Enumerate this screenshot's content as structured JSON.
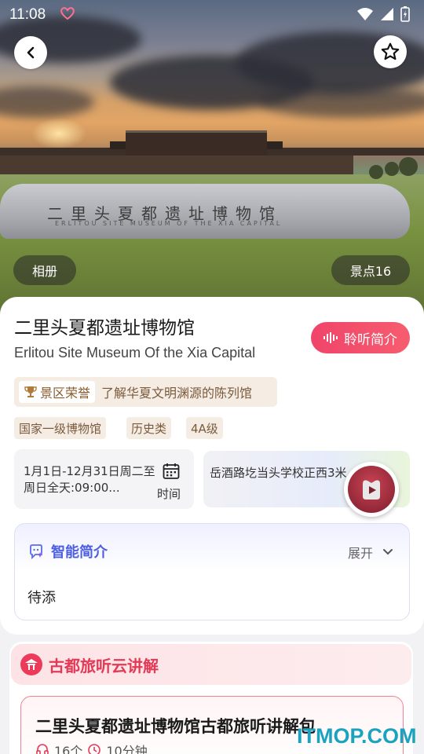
{
  "status_bar": {
    "time": "11:08"
  },
  "hero": {
    "stone_inscription": "二里头夏都遗址博物馆",
    "stone_inscription_en": "ERLITOU SITE MUSEUM OF THE XIA CAPITAL",
    "album_label": "相册",
    "spots_label": "景点16"
  },
  "header": {
    "title": "二里头夏都遗址博物馆",
    "subtitle": "Erlitou Site Museum Of the Xia Capital",
    "listen_label": "聆听简介"
  },
  "honor": {
    "tag_label": "景区荣誉",
    "text": "了解华夏文明渊源的陈列馆"
  },
  "tags": [
    "国家一级博物馆",
    "历史类",
    "4A级"
  ],
  "hours": {
    "text": "1月1日-12月31日周二至周日全天:09:00...",
    "label": "时间"
  },
  "address": {
    "text": "岳酒路圪当头学校正西3米"
  },
  "ai_intro": {
    "title": "智能简介",
    "expand_label": "展开",
    "content": "待添"
  },
  "guide": {
    "title": "古都旅听云讲解",
    "package_title": "二里头夏都遗址博物馆古都旅听讲解包",
    "count": "16个",
    "duration": "10分钟"
  },
  "watermark": "ITMOP.COM",
  "colors": {
    "accent_red": "#f0446a",
    "ai_blue": "#4d5fe0",
    "honor_bg": "#f5ede4",
    "guide_red": "#e23a56"
  }
}
